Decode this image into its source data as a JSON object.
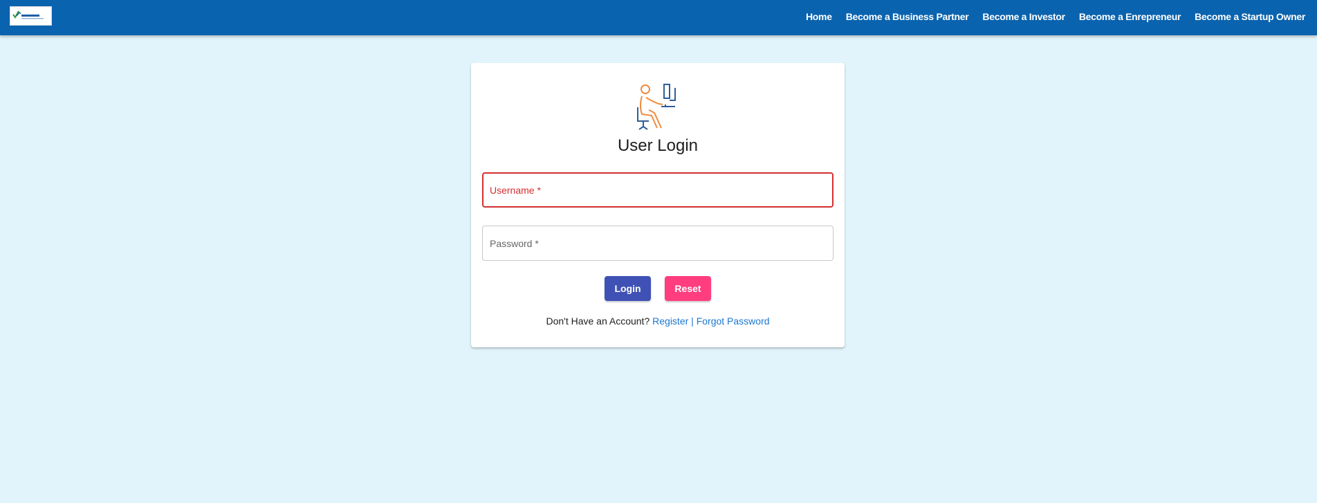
{
  "navbar": {
    "logo_icon": "entrefusion-logo",
    "links": [
      "Home",
      "Become a Business Partner",
      "Become a Investor",
      "Become a Enrepreneur",
      "Become a Startup Owner"
    ]
  },
  "login_card": {
    "illustration_icon": "person-at-computer-icon",
    "title": "User Login",
    "username": {
      "label": "Username *",
      "value": ""
    },
    "password": {
      "label": "Password *",
      "value": ""
    },
    "login_label": "Login",
    "reset_label": "Reset",
    "account_prompt": "Don't Have an Account?",
    "register_label": "Register",
    "separator": "|",
    "forgot_label": "Forgot Password"
  },
  "colors": {
    "navbar": "#0a63ae",
    "page_background": "#e1f4fc",
    "error": "#d32f2f",
    "login_button": "#3f51b5",
    "reset_button": "#ff3d7f",
    "link": "#1976d2"
  }
}
